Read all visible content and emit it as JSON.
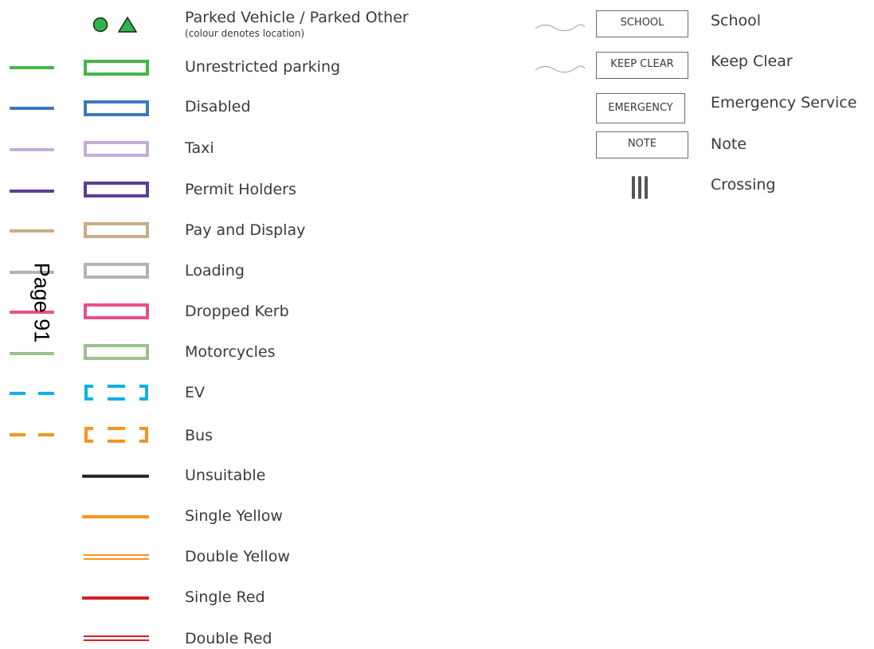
{
  "legend_left": {
    "parked": {
      "title": "Parked Vehicle / Parked Other",
      "subtitle": "(colour denotes location)",
      "circle_icon": "circle-icon",
      "triangle_icon": "triangle-icon",
      "icon_color": "#2cb34a"
    },
    "items": [
      {
        "label": "Unrestricted parking",
        "color": "#45b649"
      },
      {
        "label": "Disabled",
        "color": "#3d78c0"
      },
      {
        "label": "Taxi",
        "color": "#c2aed8"
      },
      {
        "label": "Permit Holders",
        "color": "#5b3e96"
      },
      {
        "label": "Pay and Display",
        "color": "#c8ad84"
      },
      {
        "label": "Loading",
        "color": "#b3b3b3"
      },
      {
        "label": "Dropped Kerb",
        "color": "#e84f86"
      },
      {
        "label": "Motorcycles",
        "color": "#9cc08e"
      },
      {
        "label": "EV",
        "color": "#0cb1ea"
      },
      {
        "label": "Bus",
        "color": "#f7941d"
      },
      {
        "label": "Unsuitable",
        "color": "#262a33"
      },
      {
        "label": "Single Yellow",
        "color": "#f7941d"
      },
      {
        "label": "Double Yellow",
        "color": "#f7941d"
      },
      {
        "label": "Single Red",
        "color": "#d11f26"
      },
      {
        "label": "Double Red",
        "color": "#d11f26"
      }
    ]
  },
  "legend_right": {
    "items": [
      {
        "box_text": "SCHOOL",
        "label": "School"
      },
      {
        "box_text": "KEEP CLEAR",
        "label": "Keep Clear"
      },
      {
        "box_text": "EMERGENCY",
        "label": "Emergency Service"
      },
      {
        "box_text": "NOTE",
        "label": "Note"
      },
      {
        "box_text": "",
        "label": "Crossing",
        "icon": "crossing-icon",
        "color": "#555555"
      }
    ]
  },
  "page_number": "Page 91"
}
